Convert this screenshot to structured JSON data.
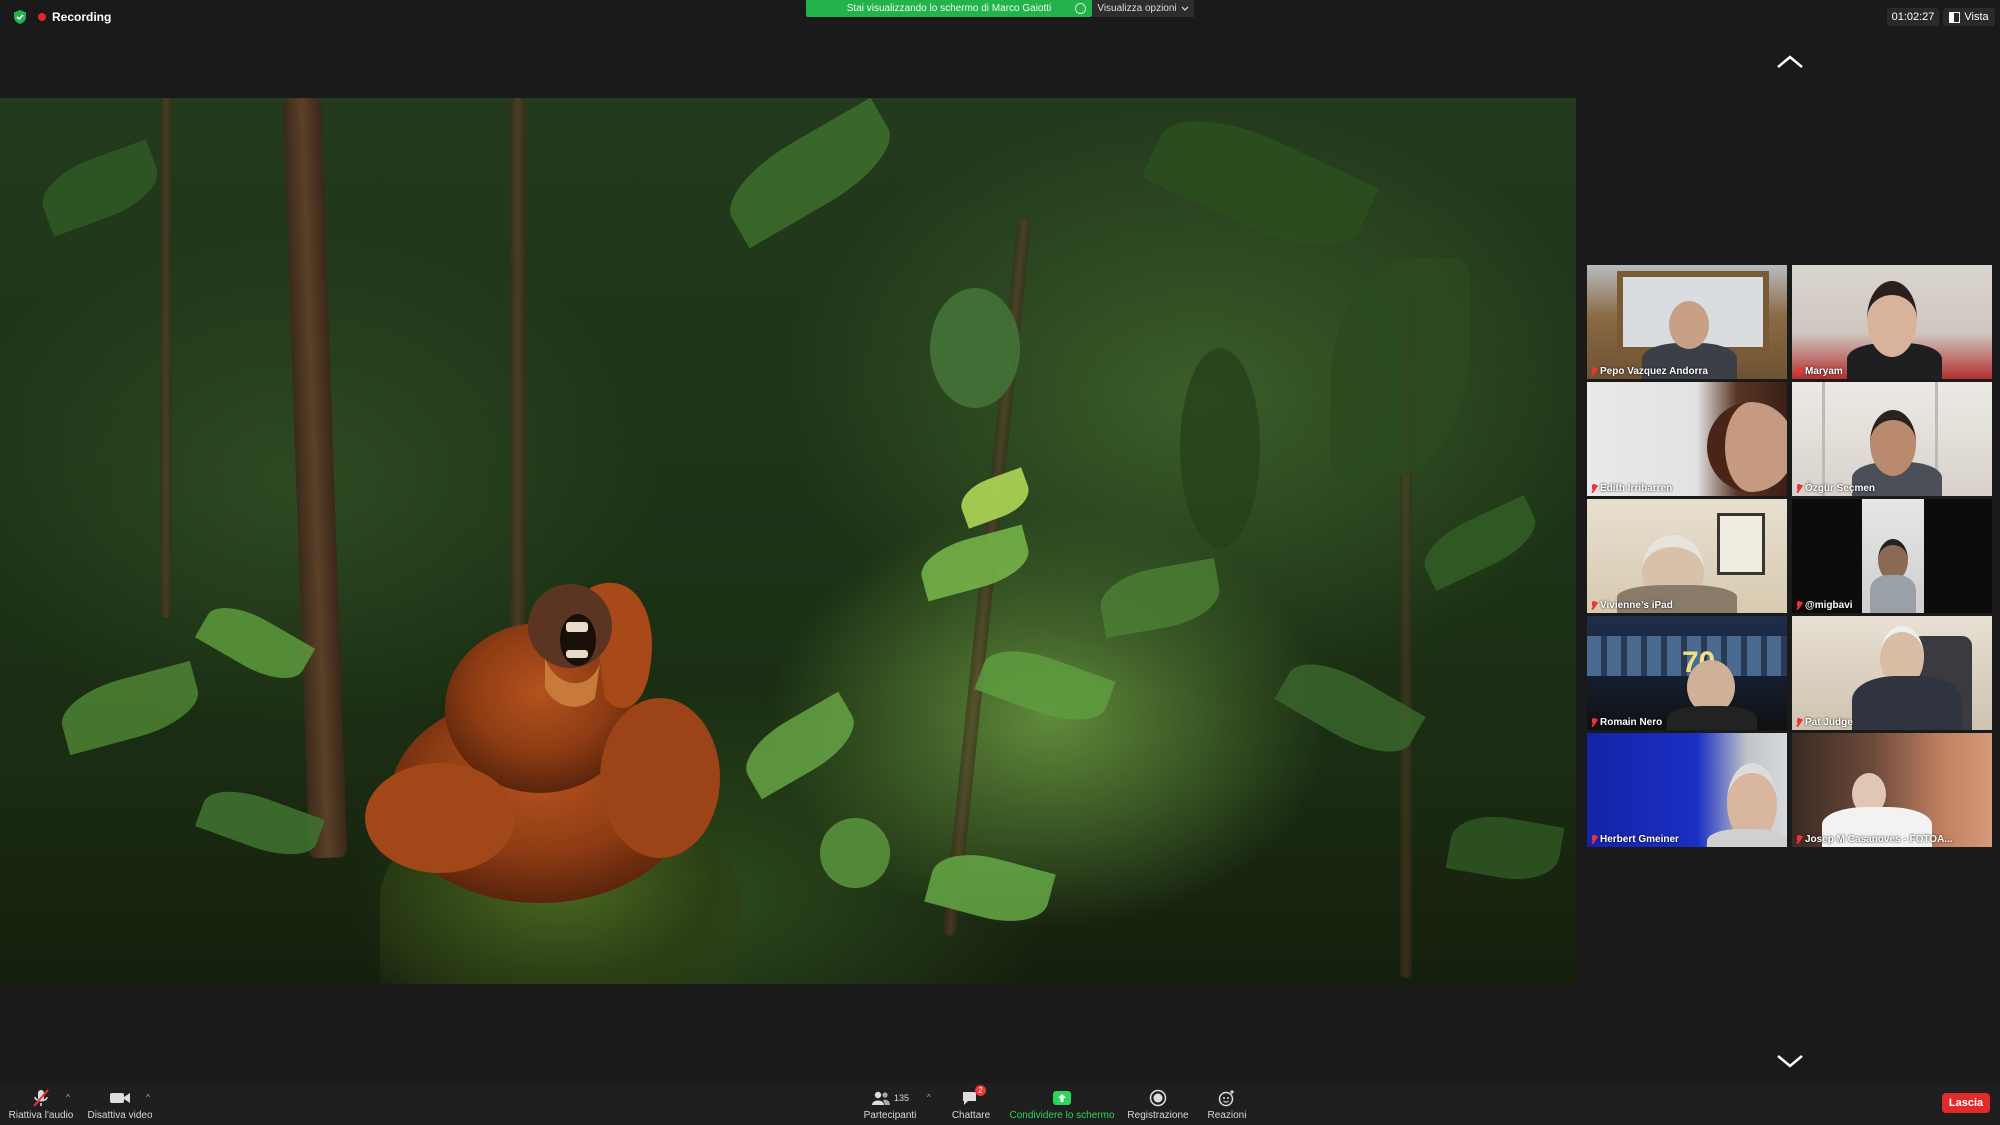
{
  "topbar": {
    "recording_label": "Recording",
    "share_banner": "Stai visualizzando lo schermo di Marco Gaiotti",
    "view_options_label": "Visualizza opzioni",
    "meeting_timer": "01:02:27",
    "view_label": "Vista"
  },
  "participants_gallery": [
    {
      "name": "Pepo Vazquez Andorra"
    },
    {
      "name": "Maryam"
    },
    {
      "name": "Edith Irribarren"
    },
    {
      "name": "Özgür Seçmen"
    },
    {
      "name": "Vivienne’s iPad"
    },
    {
      "name": "@migbavi"
    },
    {
      "name": "Romain Nero"
    },
    {
      "name": "Pat Judge"
    },
    {
      "name": "Herbert Gmeiner"
    },
    {
      "name": "Josep M Casanoves - FOTOA..."
    }
  ],
  "toolbar": {
    "unmute_label": "Riattiva l'audio",
    "stop_video_label": "Disattiva video",
    "participants_label": "Partecipanti",
    "participants_count": "135",
    "chat_label": "Chattare",
    "chat_badge": "2",
    "share_screen_label": "Condividere lo schermo",
    "record_label": "Registrazione",
    "reactions_label": "Reazioni",
    "leave_label": "Lascia"
  },
  "colors": {
    "banner_green": "#24b24b",
    "leave_red": "#e02b2b",
    "recording_red": "#e02828",
    "share_green": "#2bd45a"
  },
  "icons": [
    "shield-icon",
    "recording-dot-icon",
    "chevron-up-icon",
    "chevron-down-icon",
    "microphone-muted-icon",
    "video-camera-icon",
    "participants-icon",
    "chat-icon",
    "share-screen-icon",
    "record-icon",
    "reactions-icon"
  ]
}
